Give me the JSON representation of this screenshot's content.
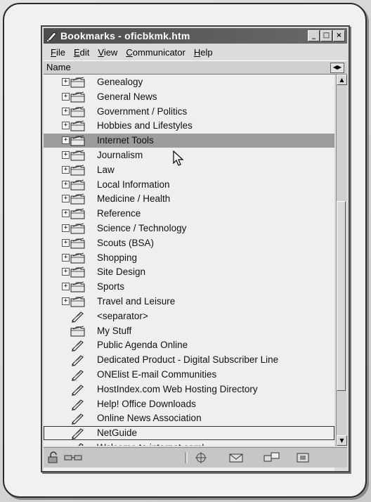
{
  "window": {
    "title": "Bookmarks - oficbkmk.htm",
    "buttons": {
      "minimize": "_",
      "maximize": "□",
      "close": "×"
    }
  },
  "menu": [
    {
      "label": "File",
      "key": "F",
      "rest": "ile"
    },
    {
      "label": "Edit",
      "key": "E",
      "rest": "dit"
    },
    {
      "label": "View",
      "key": "V",
      "rest": "iew"
    },
    {
      "label": "Communicator",
      "key": "C",
      "rest": "ommunicator"
    },
    {
      "label": "Help",
      "key": "H",
      "rest": "elp"
    }
  ],
  "column_header": "Name",
  "folders": [
    "Genealogy",
    "General News",
    "Government / Politics",
    "Hobbies and Lifestyles",
    "Internet Tools",
    "Journalism",
    "Law",
    "Local Information",
    "Medicine / Health",
    "Reference",
    "Science / Technology",
    "Scouts (BSA)",
    "Shopping",
    "Site Design",
    "Sports",
    "Travel and Leisure"
  ],
  "selected_folder": "Internet Tools",
  "bookmarks": [
    "<separator>",
    "My Stuff",
    "Public Agenda Online",
    "Dedicated Product - Digital Subscriber Line",
    "ONElist E-mail Communities",
    "HostIndex.com Web Hosting Directory",
    "Help! Office Downloads",
    "Online News Association",
    "NetGuide",
    "Welcome to internet.com!"
  ],
  "icons": {
    "folder": "folder-icon",
    "bookmark": "bookmark-icon",
    "expander": "+"
  }
}
